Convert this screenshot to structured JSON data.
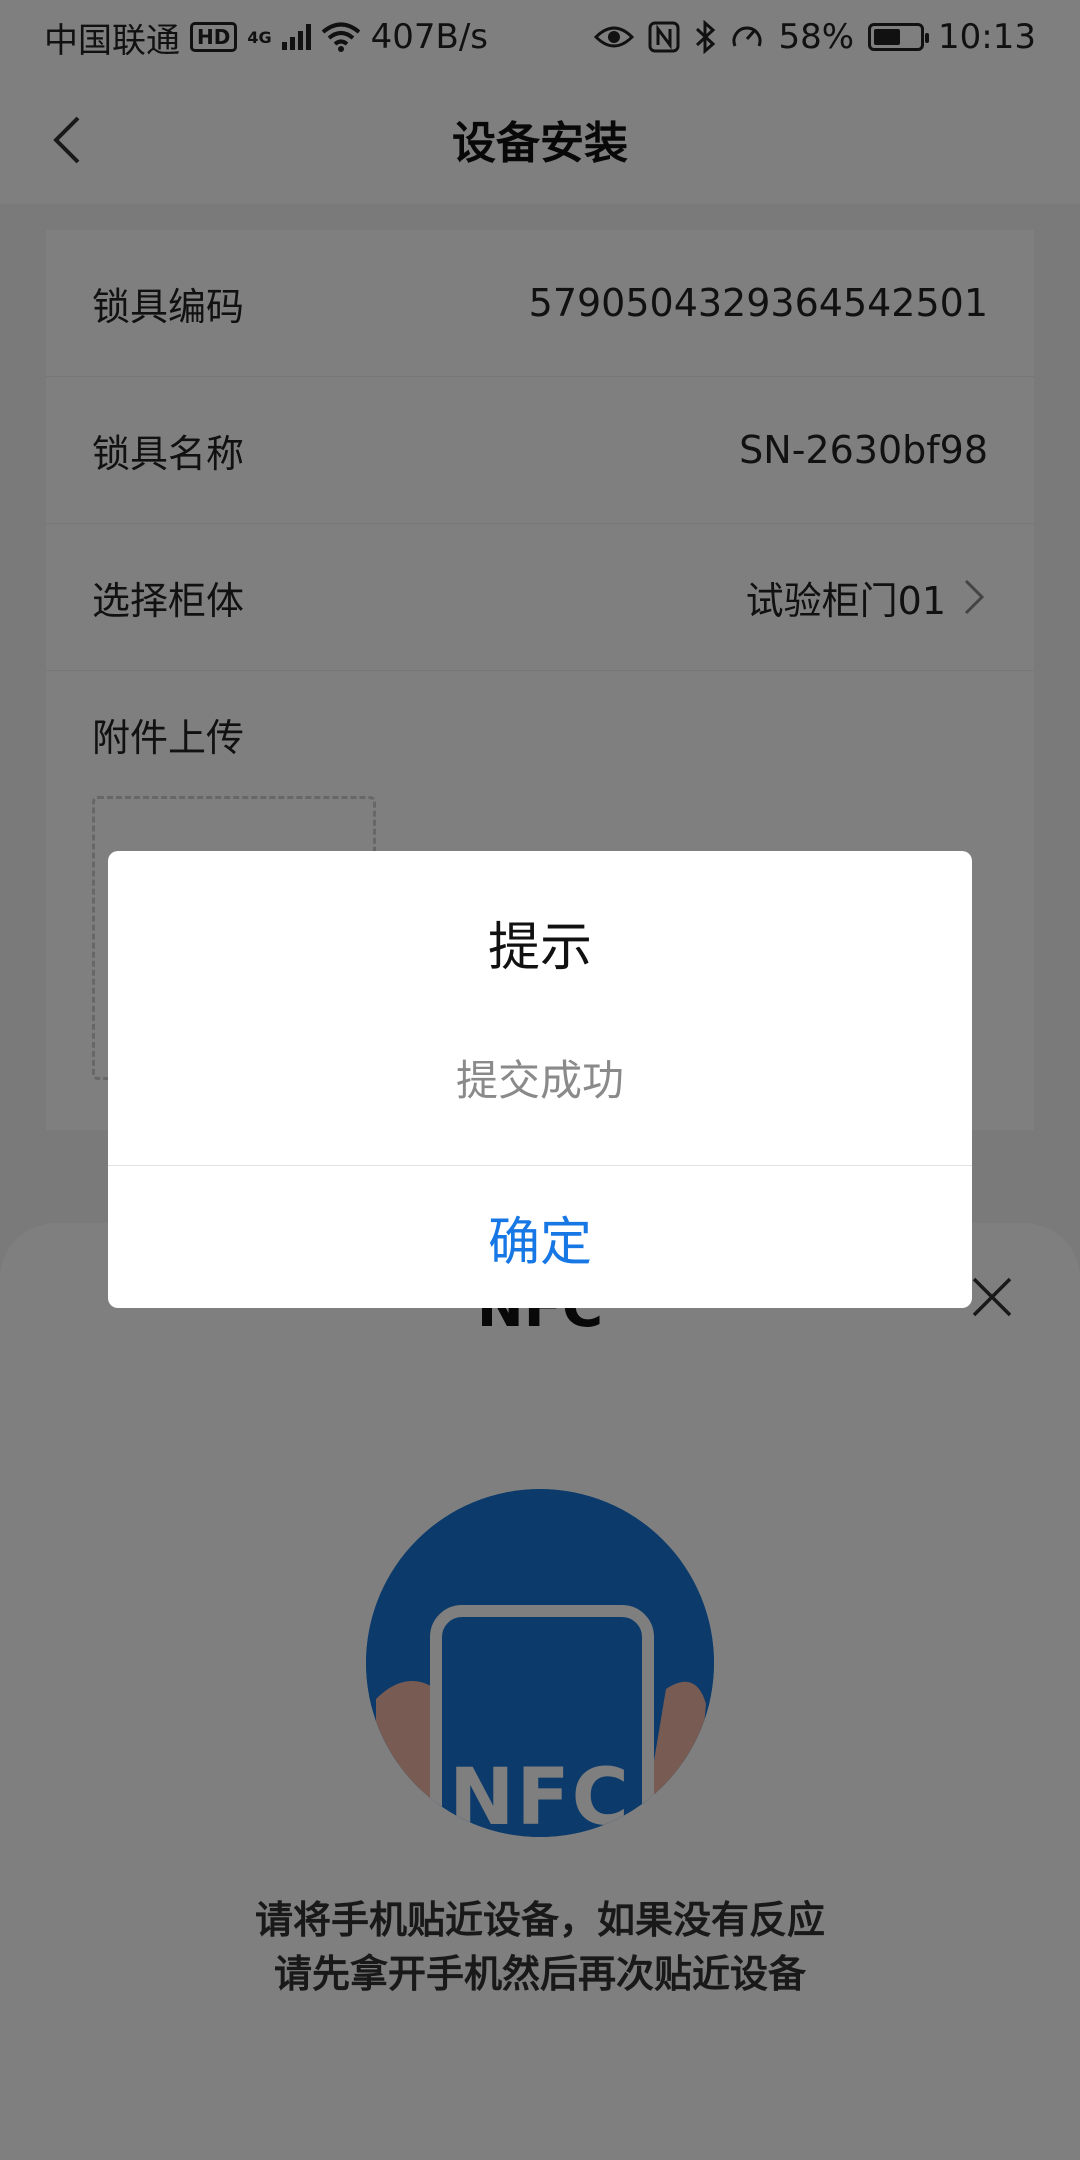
{
  "status_bar": {
    "carrier": "中国联通",
    "hd_badge": "HD",
    "network": "4G",
    "speed": "407B/s",
    "battery": "58%",
    "battery_level": 0.58,
    "time": "10:13",
    "icons": [
      "eye-icon",
      "nfc-icon",
      "bluetooth-icon",
      "speedometer-icon"
    ]
  },
  "header": {
    "title": "设备安装",
    "back_icon": "chevron-left-icon"
  },
  "form": {
    "rows": [
      {
        "label": "锁具编码",
        "value": "579050432936454250​1"
      },
      {
        "label": "锁具名称",
        "value": "SN-2630bf98"
      },
      {
        "label": "选择柜体",
        "value": "试验柜门01",
        "icon": "chevron-right-icon"
      }
    ],
    "upload_label": "附件上传"
  },
  "nfc_sheet": {
    "title": "NFC",
    "image_text": "NFC",
    "hint_line1": "请将手机贴近设备，如果没有反应",
    "hint_line2": "请先拿开手机然后再次贴近设备",
    "close_icon": "close-icon"
  },
  "dialog": {
    "title": "提示",
    "message": "提交成功",
    "confirm_label": "确定"
  },
  "colors": {
    "accent": "#1677e5",
    "nfc_blue": "#1976d2",
    "mask": "rgba(0,0,0,0.5)"
  }
}
